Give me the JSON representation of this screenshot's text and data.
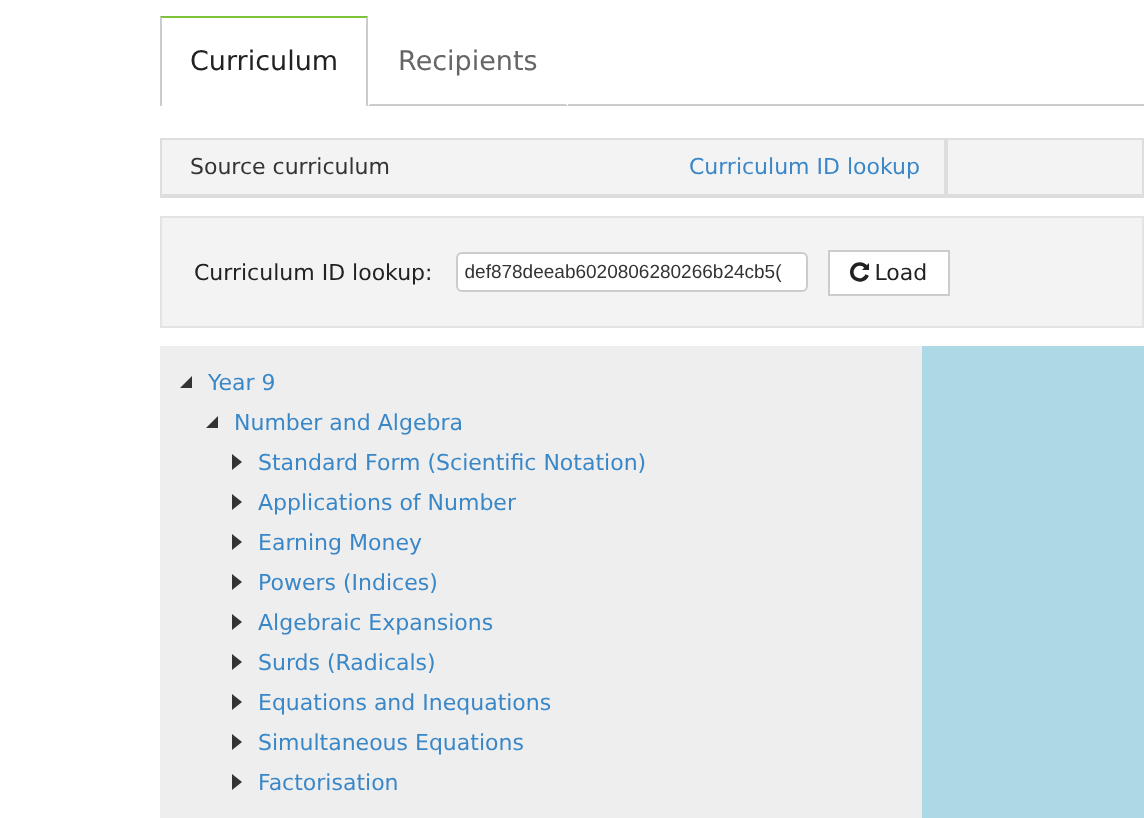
{
  "tabs": [
    {
      "label": "Curriculum",
      "selected": true
    },
    {
      "label": "Recipients",
      "selected": false
    }
  ],
  "source_bar": {
    "title": "Source curriculum",
    "link": "Curriculum ID lookup"
  },
  "lookup": {
    "label": "Curriculum ID lookup:",
    "value": "def878deeab6020806280266b24cb5(",
    "button": "Load"
  },
  "tree": [
    {
      "label": "Year 9",
      "expanded": true,
      "children": [
        {
          "label": "Number and Algebra",
          "expanded": true,
          "children": [
            {
              "label": "Standard Form (Scientific Notation)",
              "expanded": false
            },
            {
              "label": "Applications of Number",
              "expanded": false
            },
            {
              "label": "Earning Money",
              "expanded": false
            },
            {
              "label": "Powers (Indices)",
              "expanded": false
            },
            {
              "label": "Algebraic Expansions",
              "expanded": false
            },
            {
              "label": "Surds (Radicals)",
              "expanded": false
            },
            {
              "label": "Equations and Inequations",
              "expanded": false
            },
            {
              "label": "Simultaneous Equations",
              "expanded": false
            },
            {
              "label": "Factorisation",
              "expanded": false
            }
          ]
        }
      ]
    }
  ]
}
